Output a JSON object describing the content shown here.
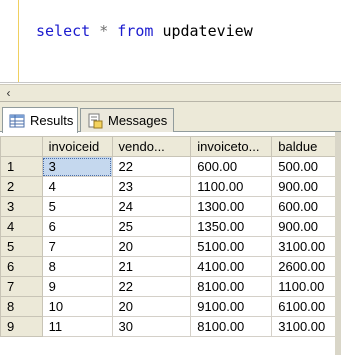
{
  "editor": {
    "code": {
      "select_kw": "select",
      "star": "*",
      "from_kw": "from",
      "table_name": "updateview"
    }
  },
  "scrollbar": {
    "left_arrow_icon": "chevron-left-icon",
    "left_arrow_glyph": "‹"
  },
  "tabs": {
    "results": {
      "label": "Results",
      "icon": "grid-icon"
    },
    "messages": {
      "label": "Messages",
      "icon": "messages-icon"
    }
  },
  "grid": {
    "columns": [
      "invoiceid",
      "vendo...",
      "invoiceto...",
      "baldue"
    ],
    "rows": [
      {
        "num": "1",
        "cells": [
          "3",
          "22",
          "600.00",
          "500.00"
        ]
      },
      {
        "num": "2",
        "cells": [
          "4",
          "23",
          "1100.00",
          "900.00"
        ]
      },
      {
        "num": "3",
        "cells": [
          "5",
          "24",
          "1300.00",
          "600.00"
        ]
      },
      {
        "num": "4",
        "cells": [
          "6",
          "25",
          "1350.00",
          "900.00"
        ]
      },
      {
        "num": "5",
        "cells": [
          "7",
          "20",
          "5100.00",
          "3100.00"
        ]
      },
      {
        "num": "6",
        "cells": [
          "8",
          "21",
          "4100.00",
          "2600.00"
        ]
      },
      {
        "num": "7",
        "cells": [
          "9",
          "22",
          "8100.00",
          "1100.00"
        ]
      },
      {
        "num": "8",
        "cells": [
          "10",
          "20",
          "9100.00",
          "6100.00"
        ]
      },
      {
        "num": "9",
        "cells": [
          "11",
          "30",
          "8100.00",
          "3100.00"
        ]
      }
    ]
  },
  "colors": {
    "keyword": "#1c1ccf",
    "selection": "#c5d8ee",
    "chrome": "#ece9d8",
    "gutter_line": "#f0d060"
  }
}
